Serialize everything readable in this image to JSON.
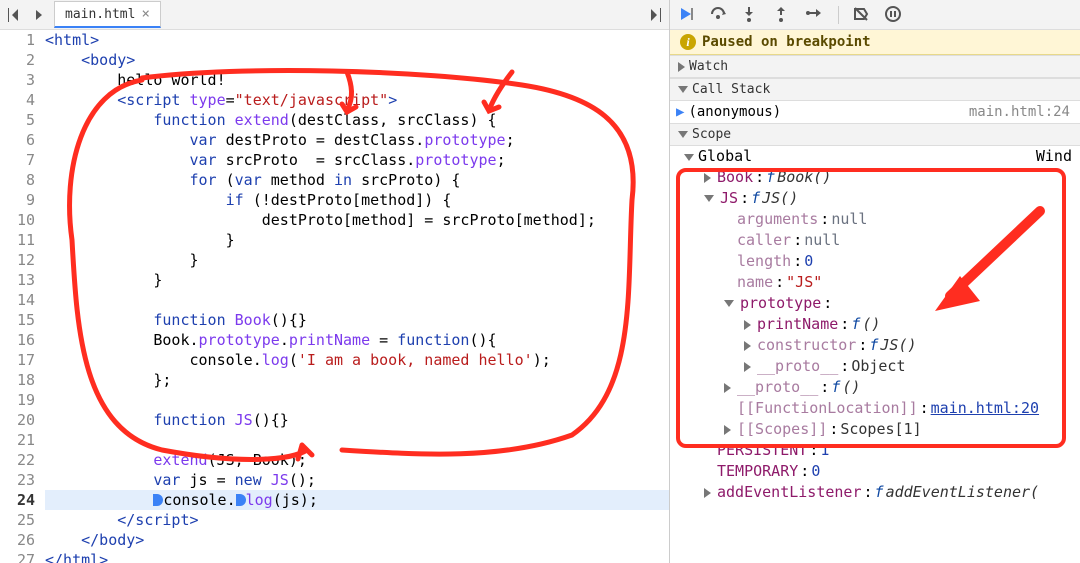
{
  "tab": {
    "filename": "main.html"
  },
  "code": {
    "lines": [
      {
        "n": 1,
        "html": "<span class='tok-tag'>&lt;html&gt;</span>"
      },
      {
        "n": 2,
        "html": "    <span class='tok-tag'>&lt;body&gt;</span>"
      },
      {
        "n": 3,
        "html": "        hello world!"
      },
      {
        "n": 4,
        "html": "        <span class='tok-tag'>&lt;script</span> <span class='tok-attr'>type</span>=<span class='tok-str'>\"text/javascript\"</span><span class='tok-tag'>&gt;</span>"
      },
      {
        "n": 5,
        "html": "            <span class='tok-kw'>function</span> <span class='tok-fn'>extend</span>(destClass, srcClass) {"
      },
      {
        "n": 6,
        "html": "                <span class='tok-kw'>var</span> destProto = destClass.<span class='tok-fn'>prototype</span>;"
      },
      {
        "n": 7,
        "html": "                <span class='tok-kw'>var</span> srcProto  = srcClass.<span class='tok-fn'>prototype</span>;"
      },
      {
        "n": 8,
        "html": "                <span class='tok-kw'>for</span> (<span class='tok-kw'>var</span> method <span class='tok-kw'>in</span> srcProto) {"
      },
      {
        "n": 9,
        "html": "                    <span class='tok-kw'>if</span> (!destProto[method]) {"
      },
      {
        "n": 10,
        "html": "                        destProto[method] = srcProto[method];"
      },
      {
        "n": 11,
        "html": "                    }"
      },
      {
        "n": 12,
        "html": "                }"
      },
      {
        "n": 13,
        "html": "            }"
      },
      {
        "n": 14,
        "html": ""
      },
      {
        "n": 15,
        "html": "            <span class='tok-kw'>function</span> <span class='tok-fn'>Book</span>(){}"
      },
      {
        "n": 16,
        "html": "            Book.<span class='tok-fn'>prototype</span>.<span class='tok-fn'>printName</span> = <span class='tok-kw'>function</span>(){"
      },
      {
        "n": 17,
        "html": "                console.<span class='tok-fn'>log</span>(<span class='tok-str'>'I am a book, named hello'</span>);"
      },
      {
        "n": 18,
        "html": "            };"
      },
      {
        "n": 19,
        "html": ""
      },
      {
        "n": 20,
        "html": "            <span class='tok-kw'>function</span> <span class='tok-fn'>JS</span>(){}"
      },
      {
        "n": 21,
        "html": ""
      },
      {
        "n": 22,
        "html": "            <span class='tok-fn'>extend</span>(JS, Book);"
      },
      {
        "n": 23,
        "html": "            <span class='tok-kw'>var</span> js = <span class='tok-kw'>new</span> <span class='tok-fn'>JS</span>();"
      },
      {
        "n": 24,
        "html": "            <span class='bp-marker'></span>console.<span class='bp-marker'></span><span class='tok-fn'>log</span>(js);",
        "current": true
      },
      {
        "n": 25,
        "html": "        <span class='tok-tag'>&lt;/script&gt;</span>"
      },
      {
        "n": 26,
        "html": "    <span class='tok-tag'>&lt;/body&gt;</span>"
      },
      {
        "n": 27,
        "html": "<span class='tok-tag'>&lt;/html&gt;</span>"
      }
    ],
    "current_line": 24
  },
  "debugger": {
    "paused_label": "Paused on breakpoint",
    "sections": {
      "watch": "Watch",
      "callstack": "Call Stack",
      "scope": "Scope"
    },
    "callstack": [
      {
        "name": "(anonymous)",
        "location": "main.html:24",
        "current": true
      }
    ],
    "scope": {
      "global_label": "Global",
      "global_value": "Wind",
      "items": [
        {
          "depth": 2,
          "arrow": "right",
          "name": "Book",
          "val_f": "f",
          "val_name": "Book()"
        },
        {
          "depth": 2,
          "arrow": "down",
          "name": "JS",
          "val_f": "f",
          "val_name": "JS()"
        },
        {
          "depth": 3,
          "dim": true,
          "name": "arguments",
          "val_null": "null"
        },
        {
          "depth": 3,
          "dim": true,
          "name": "caller",
          "val_null": "null"
        },
        {
          "depth": 3,
          "dim": true,
          "name": "length",
          "val_num": "0"
        },
        {
          "depth": 3,
          "dim": true,
          "name": "name",
          "val_str": "\"JS\""
        },
        {
          "depth": 3,
          "arrow": "down",
          "name": "prototype",
          "val_obj": ""
        },
        {
          "depth": 4,
          "arrow": "right",
          "name": "printName",
          "val_f": "f",
          "val_name": "()"
        },
        {
          "depth": 4,
          "arrow": "right",
          "dim": true,
          "name": "constructor",
          "val_f": "f",
          "val_name": "JS()"
        },
        {
          "depth": 4,
          "arrow": "right",
          "dim": true,
          "name": "__proto__",
          "val_obj": "Object"
        },
        {
          "depth": 3,
          "arrow": "right",
          "dim": true,
          "name": "__proto__",
          "val_f": "f",
          "val_name": "()"
        },
        {
          "depth": 3,
          "dim": true,
          "name": "[[FunctionLocation]]",
          "val_link": "main.html:20"
        },
        {
          "depth": 3,
          "arrow": "right",
          "dim": true,
          "name": "[[Scopes]]",
          "val_obj": "Scopes[1]"
        },
        {
          "depth": 2,
          "name": "PERSISTENT",
          "val_num": "1"
        },
        {
          "depth": 2,
          "name": "TEMPORARY",
          "val_num": "0"
        },
        {
          "depth": 2,
          "arrow": "right",
          "name": "addEventListener",
          "val_f": "f",
          "val_name": "addEventListener(",
          "italic_trail": true
        }
      ]
    }
  }
}
